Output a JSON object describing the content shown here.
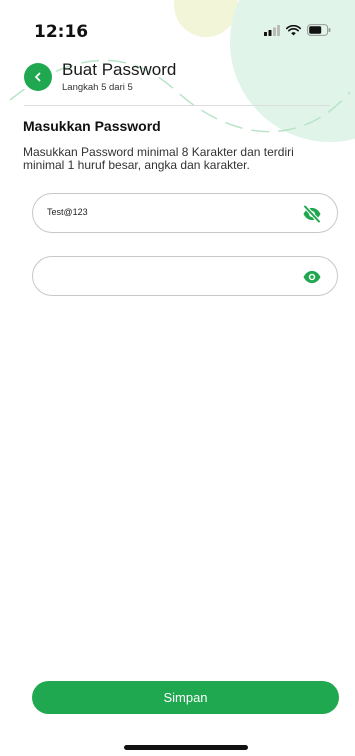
{
  "status_bar": {
    "time": "12:16"
  },
  "header": {
    "title": "Buat Password",
    "subtitle": "Langkah 5 dari 5",
    "back_icon": "chevron-left-icon"
  },
  "section": {
    "title": "Masukkan Password",
    "description": "Masukkan Password minimal 8 Karakter dan terdiri minimal 1 huruf besar, angka dan karakter."
  },
  "fields": [
    {
      "value": "Test@123",
      "placeholder": "",
      "icon": "eye-off-icon"
    },
    {
      "value": "",
      "placeholder": "",
      "icon": "eye-icon"
    }
  ],
  "submit_label": "Simpan",
  "colors": {
    "accent": "#1fa84f",
    "decor": "#dff3e6"
  }
}
